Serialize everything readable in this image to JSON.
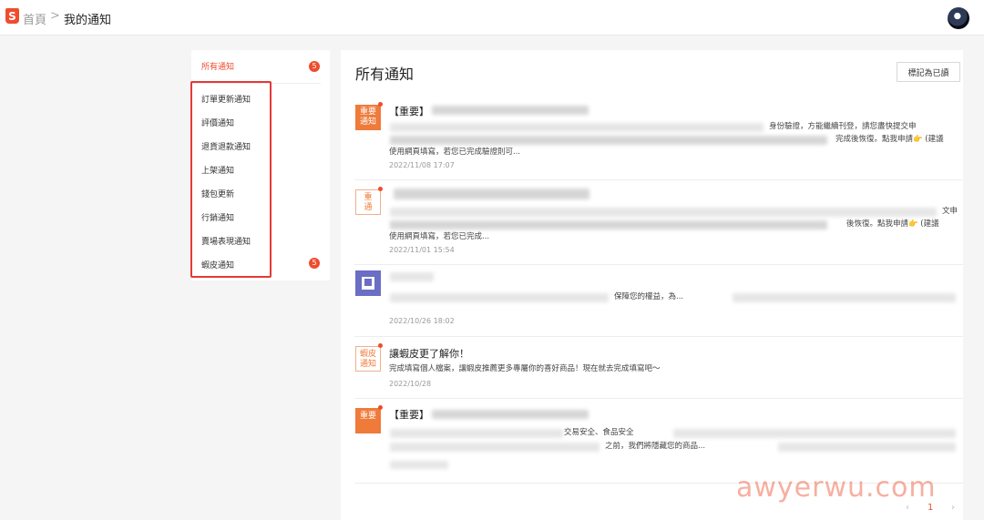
{
  "header": {
    "logo_glyph": "S",
    "breadcrumb_home": "首頁",
    "breadcrumb_separator": ">",
    "breadcrumb_current": "我的通知"
  },
  "sidebar": {
    "all_label": "所有通知",
    "all_count": "5",
    "items": [
      {
        "label": "訂單更新通知"
      },
      {
        "label": "評價通知"
      },
      {
        "label": "退貨退款通知"
      },
      {
        "label": "上架通知"
      },
      {
        "label": "錢包更新"
      },
      {
        "label": "行銷通知"
      },
      {
        "label": "賣場表現通知"
      },
      {
        "label": "蝦皮通知",
        "count": "5"
      }
    ]
  },
  "main": {
    "title": "所有通知",
    "mark_read_label": "標記為已讀",
    "notifications": [
      {
        "icon_text": "重要\n通知",
        "title": "【重要】",
        "line1_tail": "身份驗證，方能繼續刊登，請您盡快提交申",
        "line2_mid": "完成後恢復。點我申請👉 (建議",
        "line3": "使用網頁填寫，若您已完成驗證則可...",
        "date": "2022/11/08 17:07"
      },
      {
        "icon_text": "重\n通",
        "title": "",
        "line1_tail": "文申",
        "line2_mid": "後恢復。點我申請👉 (建議",
        "line3": "使用網頁填寫，若您已完成...",
        "date": "2022/11/01 15:54"
      },
      {
        "icon_text": "",
        "title": "",
        "line1_mid": "保障您的權益，為...",
        "date": "2022/10/26 18:02"
      },
      {
        "icon_text": "蝦皮\n通知",
        "title": "讓蝦皮更了解你！",
        "body": "完成填寫個人檔案，讓蝦皮推薦更多專屬你的喜好商品！現在就去完成填寫吧～",
        "date": "2022/10/28"
      },
      {
        "icon_text": "重要",
        "title": "【重要】",
        "line1_mid": "交易安全、食品安全",
        "line2_mid": "之前，我們將隱藏您的商品..."
      }
    ]
  },
  "pagination": {
    "prev": "‹",
    "current": "1",
    "next": "›"
  },
  "watermark": "awyerwu.com",
  "colors": {
    "brand": "#ee4d2d",
    "icon_orange": "#ef7a3a",
    "highlight_frame": "#e53935",
    "icon_purple": "#6a6ec4"
  }
}
